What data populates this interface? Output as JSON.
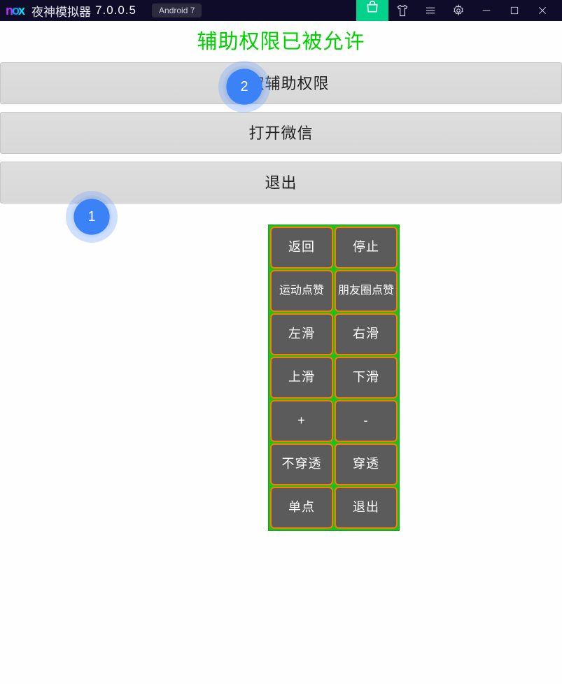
{
  "titlebar": {
    "logo_n": "n",
    "logo_o": "o",
    "logo_x": "x",
    "app_name": "夜神模拟器",
    "version": "7.0.0.5",
    "android_badge": "Android 7"
  },
  "status": "辅助权限已被允许",
  "main_buttons": {
    "grant": "获取辅助权限",
    "open_wechat": "打开微信",
    "exit": "退出"
  },
  "float": {
    "back": "返回",
    "stop": "停止",
    "sport_like": "运动点赞",
    "moments_like": "朋友圈点赞",
    "swipe_left": "左滑",
    "swipe_right": "右滑",
    "swipe_up": "上滑",
    "swipe_down": "下滑",
    "plus": "+",
    "minus": "-",
    "no_penetrate": "不穿透",
    "penetrate": "穿透",
    "single_tap": "单点",
    "quit": "退出"
  },
  "markers": {
    "m1": "1",
    "m2": "2"
  }
}
